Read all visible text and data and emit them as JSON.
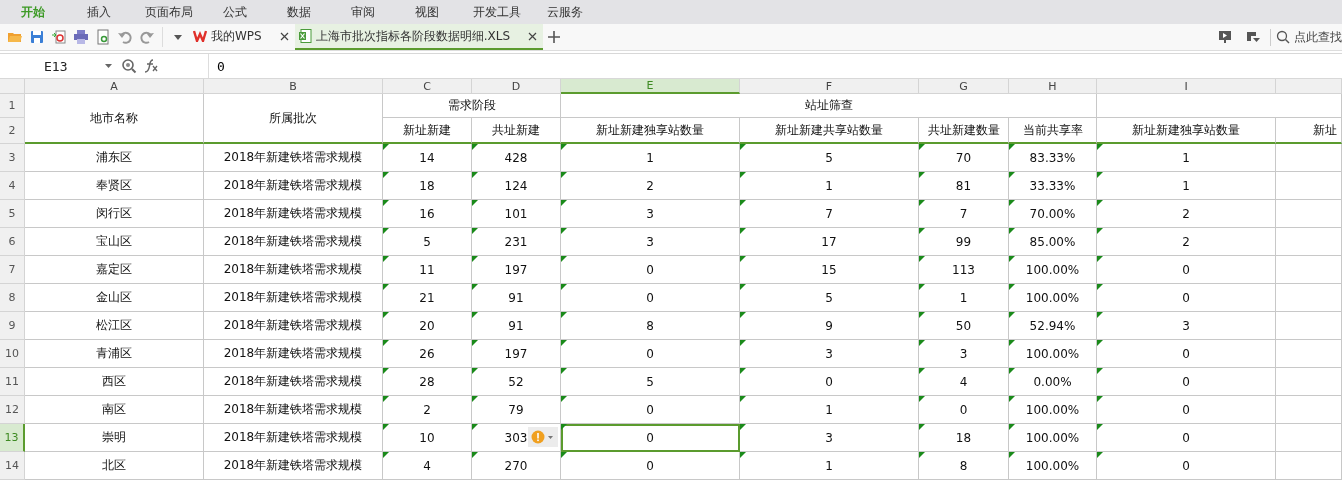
{
  "menu": [
    {
      "label": "开始",
      "selected": true
    },
    {
      "label": "插入",
      "selected": false
    },
    {
      "label": "页面布局",
      "selected": false
    },
    {
      "label": "公式",
      "selected": false
    },
    {
      "label": "数据",
      "selected": false
    },
    {
      "label": "审阅",
      "selected": false
    },
    {
      "label": "视图",
      "selected": false
    },
    {
      "label": "开发工具",
      "selected": false
    },
    {
      "label": "云服务",
      "selected": false
    }
  ],
  "doc_tabs": [
    {
      "label": "我的WPS",
      "kind": "home",
      "selected": false
    },
    {
      "label": "上海市批次指标各阶段数据明细.XLS",
      "kind": "sheet",
      "selected": true
    }
  ],
  "search": {
    "placeholder": "点此查找"
  },
  "formula_bar": {
    "cell_ref": "E13",
    "value": "0"
  },
  "columns": [
    {
      "letter": "A",
      "selected": false
    },
    {
      "letter": "B",
      "selected": false
    },
    {
      "letter": "C",
      "selected": false
    },
    {
      "letter": "D",
      "selected": false
    },
    {
      "letter": "E",
      "selected": true
    },
    {
      "letter": "F",
      "selected": false
    },
    {
      "letter": "G",
      "selected": false
    },
    {
      "letter": "H",
      "selected": false
    },
    {
      "letter": "I",
      "selected": false
    }
  ],
  "header": {
    "row_numbers": [
      "1",
      "2"
    ],
    "fixed": [
      "地市名称",
      "所属批次"
    ],
    "groups": [
      {
        "label": "需求阶段",
        "columns": [
          "新址新建",
          "共址新建"
        ]
      },
      {
        "label": "站址筛查",
        "columns": [
          "新址新建独享站数量",
          "新址新建共享站数量",
          "共址新建数量",
          "当前共享率"
        ]
      },
      {
        "columns": [
          "新址新建独享站数量",
          "新址"
        ]
      }
    ]
  },
  "rows": [
    {
      "number": "3",
      "selected": false,
      "error_marks": true,
      "warning_icon": false,
      "cells": [
        "浦东区",
        "2018年新建铁塔需求规模",
        "14",
        "428",
        "1",
        "5",
        "70",
        "83.33%",
        "1"
      ]
    },
    {
      "number": "4",
      "selected": false,
      "error_marks": true,
      "warning_icon": false,
      "cells": [
        "奉贤区",
        "2018年新建铁塔需求规模",
        "18",
        "124",
        "2",
        "1",
        "81",
        "33.33%",
        "1"
      ]
    },
    {
      "number": "5",
      "selected": false,
      "error_marks": true,
      "warning_icon": false,
      "cells": [
        "闵行区",
        "2018年新建铁塔需求规模",
        "16",
        "101",
        "3",
        "7",
        "7",
        "70.00%",
        "2"
      ]
    },
    {
      "number": "6",
      "selected": false,
      "error_marks": true,
      "warning_icon": false,
      "cells": [
        "宝山区",
        "2018年新建铁塔需求规模",
        "5",
        "231",
        "3",
        "17",
        "99",
        "85.00%",
        "2"
      ]
    },
    {
      "number": "7",
      "selected": false,
      "error_marks": true,
      "warning_icon": false,
      "cells": [
        "嘉定区",
        "2018年新建铁塔需求规模",
        "11",
        "197",
        "0",
        "15",
        "113",
        "100.00%",
        "0"
      ]
    },
    {
      "number": "8",
      "selected": false,
      "error_marks": true,
      "warning_icon": false,
      "cells": [
        "金山区",
        "2018年新建铁塔需求规模",
        "21",
        "91",
        "0",
        "5",
        "1",
        "100.00%",
        "0"
      ]
    },
    {
      "number": "9",
      "selected": false,
      "error_marks": true,
      "warning_icon": false,
      "cells": [
        "松江区",
        "2018年新建铁塔需求规模",
        "20",
        "91",
        "8",
        "9",
        "50",
        "52.94%",
        "3"
      ]
    },
    {
      "number": "10",
      "selected": false,
      "error_marks": true,
      "warning_icon": false,
      "cells": [
        "青浦区",
        "2018年新建铁塔需求规模",
        "26",
        "197",
        "0",
        "3",
        "3",
        "100.00%",
        "0"
      ]
    },
    {
      "number": "11",
      "selected": false,
      "error_marks": true,
      "warning_icon": false,
      "cells": [
        "西区",
        "2018年新建铁塔需求规模",
        "28",
        "52",
        "5",
        "0",
        "4",
        "0.00%",
        "0"
      ]
    },
    {
      "number": "12",
      "selected": false,
      "error_marks": true,
      "warning_icon": false,
      "cells": [
        "南区",
        "2018年新建铁塔需求规模",
        "2",
        "79",
        "0",
        "1",
        "0",
        "100.00%",
        "0"
      ]
    },
    {
      "number": "13",
      "selected": true,
      "error_marks": true,
      "warning_icon": true,
      "cells": [
        "崇明",
        "2018年新建铁塔需求规模",
        "10",
        "303",
        "0",
        "3",
        "18",
        "100.00%",
        "0"
      ]
    },
    {
      "number": "14",
      "selected": false,
      "error_marks": true,
      "warning_icon": false,
      "cells": [
        "北区",
        "2018年新建铁塔需求规模",
        "4",
        "270",
        "0",
        "1",
        "8",
        "100.00%",
        "0"
      ]
    }
  ]
}
